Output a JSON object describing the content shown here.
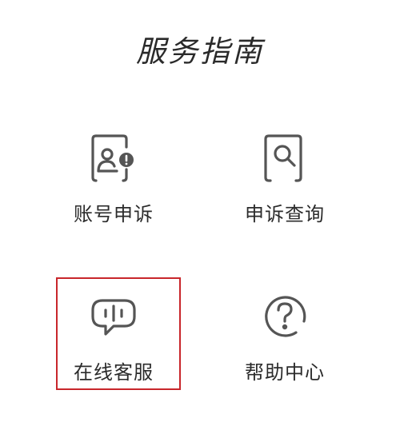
{
  "page": {
    "title": "服务指南"
  },
  "items": [
    {
      "label": "账号申诉",
      "icon": "account-appeal-icon"
    },
    {
      "label": "申诉查询",
      "icon": "appeal-query-icon"
    },
    {
      "label": "在线客服",
      "icon": "online-service-icon"
    },
    {
      "label": "帮助中心",
      "icon": "help-center-icon"
    }
  ],
  "colors": {
    "icon": "#555555",
    "text": "#2b2b2b",
    "highlight": "#c8262b"
  }
}
